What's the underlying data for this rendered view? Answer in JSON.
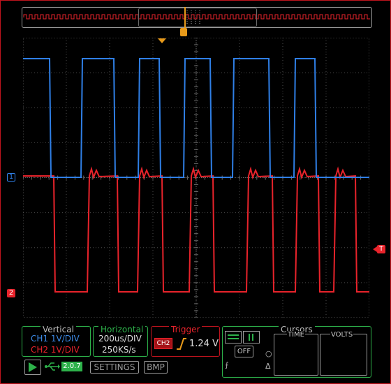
{
  "markers": {
    "ch1": "1",
    "ch2": "2",
    "trigger_level": "T",
    "trigger_position": "T"
  },
  "vertical": {
    "title": "Vertical",
    "ch1": "CH1 1V/DIV",
    "ch2": "CH2 1V/DIV"
  },
  "horizontal": {
    "title": "Horizontal",
    "timebase": "200us/DIV",
    "sample_rate": "250KS/s"
  },
  "trigger": {
    "title": "Trigger",
    "source": "CH2",
    "slope_icon": "rising-edge-icon",
    "level": "1.24 V"
  },
  "cursors": {
    "title": "Cursors",
    "off_label": "OFF",
    "time_label": "TIME",
    "volts_label": "VOLTS",
    "icons": [
      "horizontal-lines-icon",
      "vertical-lines-icon",
      "falling-edge-icon",
      "circle-icon",
      "delta-icon"
    ]
  },
  "toolbar": {
    "version": "2.0.7",
    "settings_label": "SETTINGS",
    "bmp_label": "BMP",
    "icons": [
      "play-icon",
      "usb-icon"
    ]
  },
  "colors": {
    "ch1": "#2f7fe6",
    "ch2": "#e8232b",
    "grid": "#4a4a4a",
    "accent_green": "#2db14a",
    "trigger_orange": "#e89a1a"
  },
  "waveforms": {
    "ch1_rising": [
      2,
      83,
      165,
      230,
      300,
      388,
      508,
      620
    ],
    "ch1_falling": [
      38,
      130,
      195,
      268,
      352,
      418,
      568
    ],
    "ch2_falling": [
      44,
      135,
      199,
      272,
      357,
      423,
      476,
      573
    ],
    "ch2_rising": [
      92,
      164,
      238,
      320,
      390,
      445,
      527
    ]
  }
}
